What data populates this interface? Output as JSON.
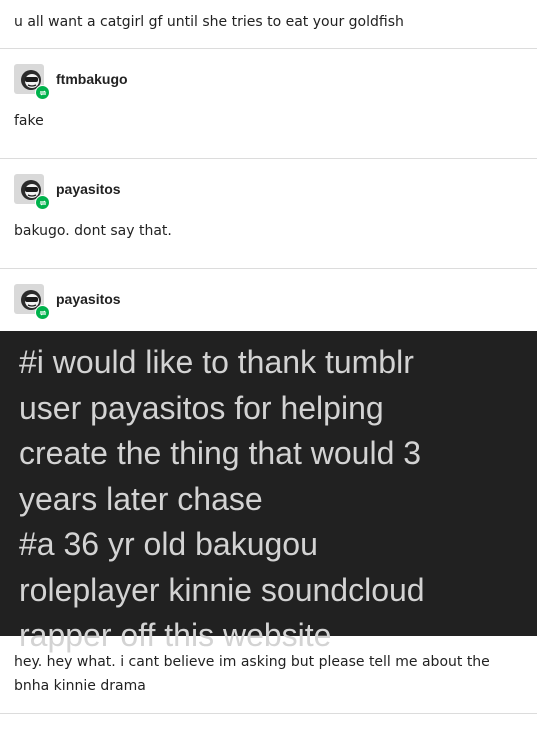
{
  "posts": [
    {
      "text": "u all want a catgirl gf until she tries to eat your goldfish"
    },
    {
      "username": "ftmbakugo",
      "text": "fake"
    },
    {
      "username": "payasitos",
      "text": "bakugo. dont say that."
    },
    {
      "username": "payasitos"
    }
  ],
  "tags_lines": [
    "#i would like to thank tumblr",
    "user payasitos for helping",
    "create the thing that would 3",
    "years later chase",
    "#a 36 yr old bakugou",
    "roleplayer kinnie soundcloud",
    "rapper off this website"
  ],
  "reply": {
    "line1": "hey. hey what. i cant believe im asking but please tell me about the",
    "line2": "bnha kinnie drama"
  },
  "colors": {
    "reblog_badge": "#00b24c",
    "tags_background": "#212121",
    "tags_text": "#d3d3d3"
  }
}
